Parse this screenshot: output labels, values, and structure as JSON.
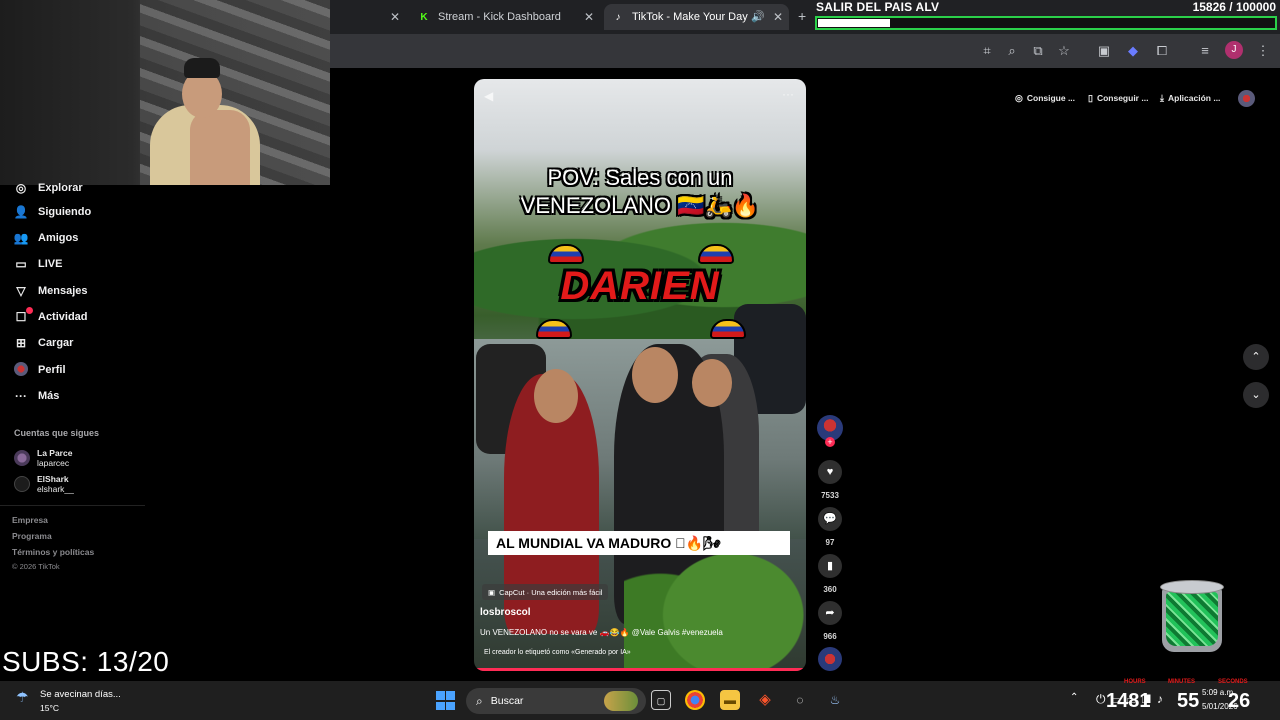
{
  "browser": {
    "tabs": [
      {
        "title": "Stream - Kick Dashboard",
        "icon": "kick-icon",
        "active": false
      },
      {
        "title": "TikTok - Make Your Day",
        "icon": "tiktok-icon",
        "active": true
      }
    ],
    "toolbar_icons": [
      "translate-icon",
      "zoom-icon",
      "cast-icon",
      "star-icon",
      "extension-icon",
      "copilot-icon",
      "puzzle-icon",
      "media-icon"
    ],
    "profile_initial": "J"
  },
  "goal": {
    "title": "SALIR DEL PAIS ALV",
    "count": "15826 / 100000",
    "progress_fraction": 0.158,
    "bar_color": "#2bd14a"
  },
  "sidebar": {
    "items": [
      {
        "label": "Explorar",
        "icon": "compass-icon"
      },
      {
        "label": "Siguiendo",
        "icon": "following-icon"
      },
      {
        "label": "Amigos",
        "icon": "friends-icon"
      },
      {
        "label": "LIVE",
        "icon": "live-icon"
      },
      {
        "label": "Mensajes",
        "icon": "messages-icon"
      },
      {
        "label": "Actividad",
        "icon": "activity-icon",
        "badge": true
      },
      {
        "label": "Cargar",
        "icon": "upload-icon"
      },
      {
        "label": "Perfil",
        "icon": "profile-icon"
      },
      {
        "label": "Más",
        "icon": "more-icon"
      }
    ],
    "following_title": "Cuentas que sigues",
    "following": [
      {
        "name": "La Parce",
        "handle": "laparcec"
      },
      {
        "name": "ElShark",
        "handle": "elshark__"
      }
    ],
    "footer": [
      "Empresa",
      "Programa",
      "Términos y políticas"
    ],
    "copyright": "© 2026 TikTok"
  },
  "video": {
    "caption_line1": "POV: Sales con un",
    "caption_line2": "VENEZOLANO 🇻🇪🛵🔥",
    "title_graphic": "DARIEN",
    "banner": "AL MUNDIAL VA MADURO 🏻🔥🌬",
    "capcut_tag": "CapCut · Una edición más fácil",
    "username": "losbroscol",
    "description": "Un VENEZOLANO no se vara ve 🚗😂🔥 @Vale Galvis #venezuela",
    "ai_label": "El creador lo etiquetó como «Generado por IA»"
  },
  "actions": {
    "likes": "7533",
    "comments": "97",
    "saves": "360",
    "shares": "966"
  },
  "top_pills": [
    {
      "label": "Consigue ...",
      "icon": "coin-icon"
    },
    {
      "label": "Conseguir ...",
      "icon": "phone-icon"
    },
    {
      "label": "Aplicación ...",
      "icon": "download-icon"
    }
  ],
  "overlay": {
    "subs": "SUBS: 13/20"
  },
  "taskbar": {
    "weather_title": "Se avecinan días...",
    "weather_temp": "15°C",
    "search_placeholder": "Buscar",
    "clock_time": "5:09 a.m.",
    "clock_date": "5/01/2026",
    "timer_hours": "1481",
    "timer_minutes": "55",
    "timer_seconds": "26",
    "timer_labels": [
      "HOURS",
      "MINUTES",
      "SECONDS"
    ]
  }
}
